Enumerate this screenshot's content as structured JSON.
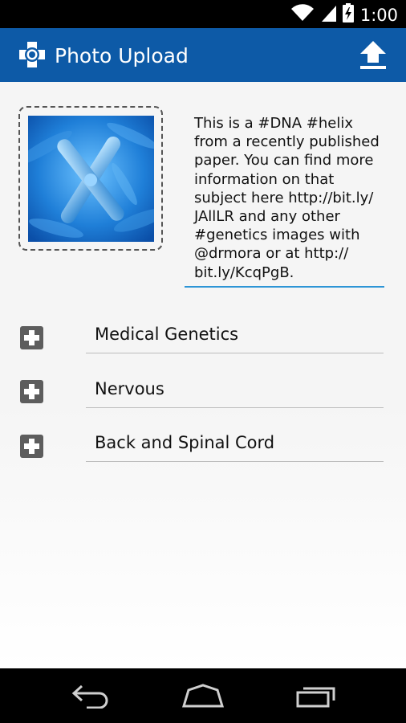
{
  "status_bar": {
    "time": "1:00",
    "icons": [
      "wifi-icon",
      "signal-icon",
      "battery-charging-icon"
    ]
  },
  "app_bar": {
    "title": "Photo Upload",
    "logo_icon": "camera-plus-logo-icon",
    "action_icon": "upload-icon",
    "color": "#0d5aa7"
  },
  "photo": {
    "icon": "chromosome-image"
  },
  "caption": {
    "text": "This is a #DNA #helix\nfrom a recently published\npaper.  You can find more\ninformation on that\nsubject here http://bit.ly/\nJAllLR and any other\n#genetics images with\n@drmora or at http://\nbit.ly/KcqPgB."
  },
  "categories": [
    {
      "label": "Medical Genetics"
    },
    {
      "label": "Nervous"
    },
    {
      "label": "Back and Spinal Cord"
    }
  ],
  "nav_bar": {
    "buttons": [
      "back-icon",
      "home-icon",
      "recents-icon"
    ]
  },
  "colors": {
    "accent": "#2d95d6",
    "plus_button": "#5d5d5d"
  }
}
